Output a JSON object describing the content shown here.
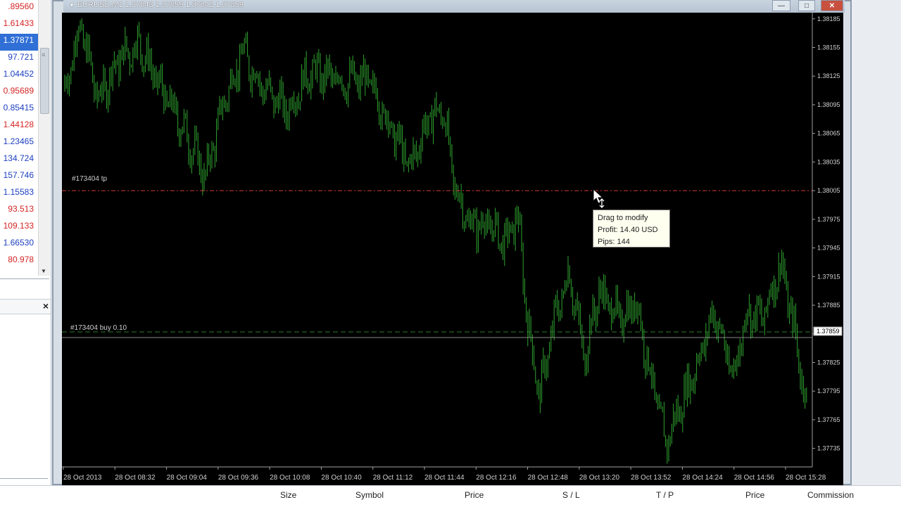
{
  "market_watch": {
    "prices": [
      {
        "text": ".89560",
        "color": "red"
      },
      {
        "text": "1.61433",
        "color": "red"
      },
      {
        "text": "1.37871",
        "color": "selected"
      },
      {
        "text": "97.721",
        "color": "blue"
      },
      {
        "text": "1.04452",
        "color": "blue"
      },
      {
        "text": "0.95689",
        "color": "red"
      },
      {
        "text": "0.85415",
        "color": "blue"
      },
      {
        "text": "1.44128",
        "color": "red"
      },
      {
        "text": "1.23465",
        "color": "blue"
      },
      {
        "text": "134.724",
        "color": "blue"
      },
      {
        "text": "157.746",
        "color": "blue"
      },
      {
        "text": "1.15583",
        "color": "blue"
      },
      {
        "text": "93.513",
        "color": "red"
      },
      {
        "text": "109.133",
        "color": "red"
      },
      {
        "text": "1.66530",
        "color": "blue"
      },
      {
        "text": "80.978",
        "color": "red"
      }
    ],
    "close_symbol": "×"
  },
  "chart_window": {
    "title": "EURUSD,M1  1.37843 1.37859 1.37842 1.37859",
    "minimize": "—",
    "maximize": "□",
    "close": "✕"
  },
  "chart_data": {
    "type": "line",
    "symbol": "EURUSD",
    "timeframe": "M1",
    "ylim": [
      1.3772,
      1.3819
    ],
    "y_ticks": [
      "1.38185",
      "1.38155",
      "1.38125",
      "1.38095",
      "1.38065",
      "1.38035",
      "1.38005",
      "1.37975",
      "1.37945",
      "1.37915",
      "1.37885",
      "1.37855",
      "1.37825",
      "1.37795",
      "1.37765",
      "1.37735"
    ],
    "x_ticks": [
      "28 Oct 2013",
      "28 Oct 08:32",
      "28 Oct 09:04",
      "28 Oct 09:36",
      "28 Oct 10:08",
      "28 Oct 10:40",
      "28 Oct 11:12",
      "28 Oct 11:44",
      "28 Oct 12:16",
      "28 Oct 12:48",
      "28 Oct 13:20",
      "28 Oct 13:52",
      "28 Oct 14:24",
      "28 Oct 14:56",
      "28 Oct 15:28"
    ],
    "price_path": [
      {
        "t": 0,
        "p": 1.3811
      },
      {
        "t": 0.02,
        "p": 1.3818
      },
      {
        "t": 0.045,
        "p": 1.381
      },
      {
        "t": 0.07,
        "p": 1.3814
      },
      {
        "t": 0.1,
        "p": 1.3816
      },
      {
        "t": 0.13,
        "p": 1.3811
      },
      {
        "t": 0.16,
        "p": 1.3807
      },
      {
        "t": 0.19,
        "p": 1.3802
      },
      {
        "t": 0.215,
        "p": 1.381
      },
      {
        "t": 0.24,
        "p": 1.3815
      },
      {
        "t": 0.27,
        "p": 1.3811
      },
      {
        "t": 0.3,
        "p": 1.3809
      },
      {
        "t": 0.33,
        "p": 1.3813
      },
      {
        "t": 0.37,
        "p": 1.3812
      },
      {
        "t": 0.41,
        "p": 1.3812
      },
      {
        "t": 0.44,
        "p": 1.3807
      },
      {
        "t": 0.465,
        "p": 1.3803
      },
      {
        "t": 0.49,
        "p": 1.3808
      },
      {
        "t": 0.51,
        "p": 1.3809
      },
      {
        "t": 0.525,
        "p": 1.3801
      },
      {
        "t": 0.545,
        "p": 1.3797
      },
      {
        "t": 0.57,
        "p": 1.3797
      },
      {
        "t": 0.595,
        "p": 1.3795
      },
      {
        "t": 0.61,
        "p": 1.3798
      },
      {
        "t": 0.625,
        "p": 1.3786
      },
      {
        "t": 0.64,
        "p": 1.3779
      },
      {
        "t": 0.66,
        "p": 1.3787
      },
      {
        "t": 0.68,
        "p": 1.3792
      },
      {
        "t": 0.7,
        "p": 1.3783
      },
      {
        "t": 0.72,
        "p": 1.379
      },
      {
        "t": 0.75,
        "p": 1.3787
      },
      {
        "t": 0.77,
        "p": 1.3789
      },
      {
        "t": 0.79,
        "p": 1.3781
      },
      {
        "t": 0.81,
        "p": 1.3774
      },
      {
        "t": 0.835,
        "p": 1.3779
      },
      {
        "t": 0.855,
        "p": 1.3783
      },
      {
        "t": 0.875,
        "p": 1.3788
      },
      {
        "t": 0.9,
        "p": 1.3781
      },
      {
        "t": 0.92,
        "p": 1.3788
      },
      {
        "t": 0.94,
        "p": 1.3787
      },
      {
        "t": 0.965,
        "p": 1.3793
      },
      {
        "t": 0.985,
        "p": 1.3785
      },
      {
        "t": 1.0,
        "p": 1.3778
      }
    ],
    "tp_level": 1.38005,
    "buy_level": 1.37857,
    "current_price": "1.37859"
  },
  "orders": {
    "tp_label": "#173404 tp",
    "buy_label": "#173404 buy 0.10"
  },
  "tooltip": {
    "line1": "Drag to modify",
    "line2": "Profit: 14.40 USD",
    "line3": "Pips: 144"
  },
  "terminal": {
    "columns": [
      {
        "label": "Size",
        "pos": "l1"
      },
      {
        "label": "Symbol",
        "pos": "l2"
      },
      {
        "label": "Price",
        "pos": "l3"
      },
      {
        "label": "S / L",
        "pos": "l4"
      },
      {
        "label": "T / P",
        "pos": "l5"
      },
      {
        "label": "Price",
        "pos": "l6"
      },
      {
        "label": "Commission",
        "pos": "l7"
      }
    ]
  },
  "colors": {
    "chart_bg": "#000000",
    "bar_green": "#2fa32f",
    "tp_line": "#d23a3a",
    "buy_line": "#2d7a2d",
    "axis_text": "#d0d0d0"
  }
}
